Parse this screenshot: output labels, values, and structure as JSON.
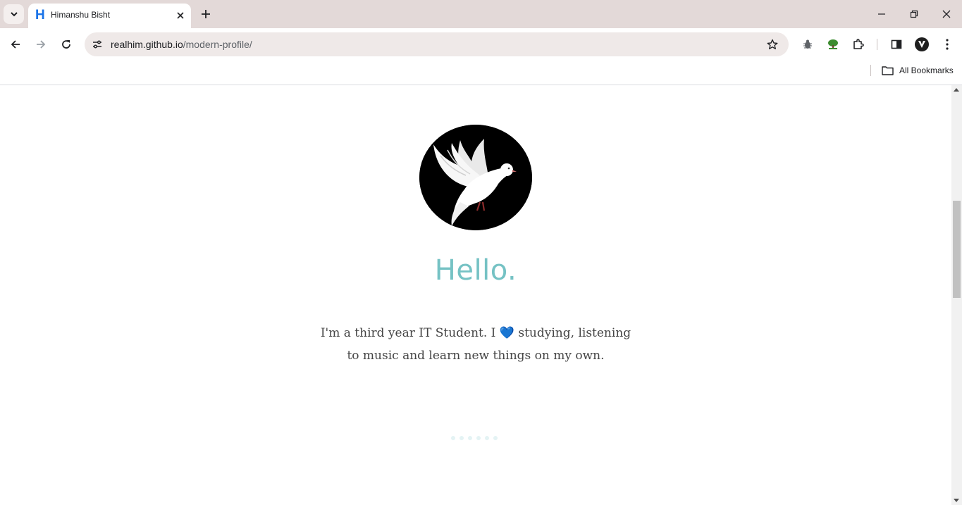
{
  "browser": {
    "tab": {
      "title": "Himanshu Bisht",
      "favicon_letter": "H"
    },
    "address": {
      "domain": "realhim.github.io",
      "path": "/modern-profile/"
    },
    "bookmarks": {
      "all_label": "All Bookmarks"
    },
    "icons": {
      "tab_search": "chevron-down-icon",
      "tab_close": "close-icon",
      "new_tab": "plus-icon",
      "back": "arrow-left-icon",
      "forward": "arrow-right-icon",
      "reload": "reload-icon",
      "site_info": "tune-icon",
      "bookmark": "star-icon",
      "extensions": [
        "bug-extension-icon",
        "tree-extension-icon",
        "puzzle-icon"
      ],
      "side_panel": "side-panel-icon",
      "profile": "avatar-icon",
      "menu": "kebab-menu-icon",
      "folder": "folder-icon"
    }
  },
  "page": {
    "avatar_alt": "dove",
    "greeting": "Hello.",
    "bio_before_heart": "I'm a third year IT Student. I ",
    "heart": "💙",
    "bio_after_heart": " studying, listening to music and learn new things on my own.",
    "loader_dots": 6,
    "colors": {
      "greeting": "#75c2c4",
      "heart": "#1a6fc9"
    }
  }
}
